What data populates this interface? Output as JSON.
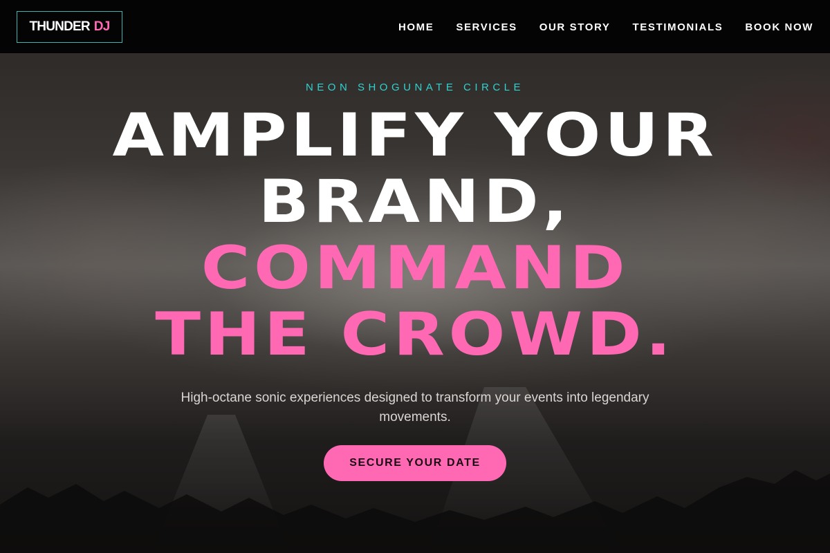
{
  "brand": {
    "name": "THUNDER",
    "accent_text": "DJ",
    "accent_color": "#ff69b4",
    "border_color": "#3fb5b2"
  },
  "nav": {
    "items": [
      {
        "label": "HOME"
      },
      {
        "label": "SERVICES"
      },
      {
        "label": "OUR STORY"
      },
      {
        "label": "TESTIMONIALS"
      },
      {
        "label": "BOOK NOW"
      }
    ]
  },
  "hero": {
    "eyebrow": "NEON SHOGUNATE CIRCLE",
    "eyebrow_color": "#2fd3d1",
    "headline": {
      "line1": "AMPLIFY YOUR",
      "line2": "BRAND,",
      "line3": "COMMAND",
      "line4": "THE CROWD."
    },
    "highlight_color": "#ff69b4",
    "subtitle": "High-octane sonic experiences designed to transform your events into legendary movements.",
    "cta_label": "SECURE YOUR DATE"
  }
}
